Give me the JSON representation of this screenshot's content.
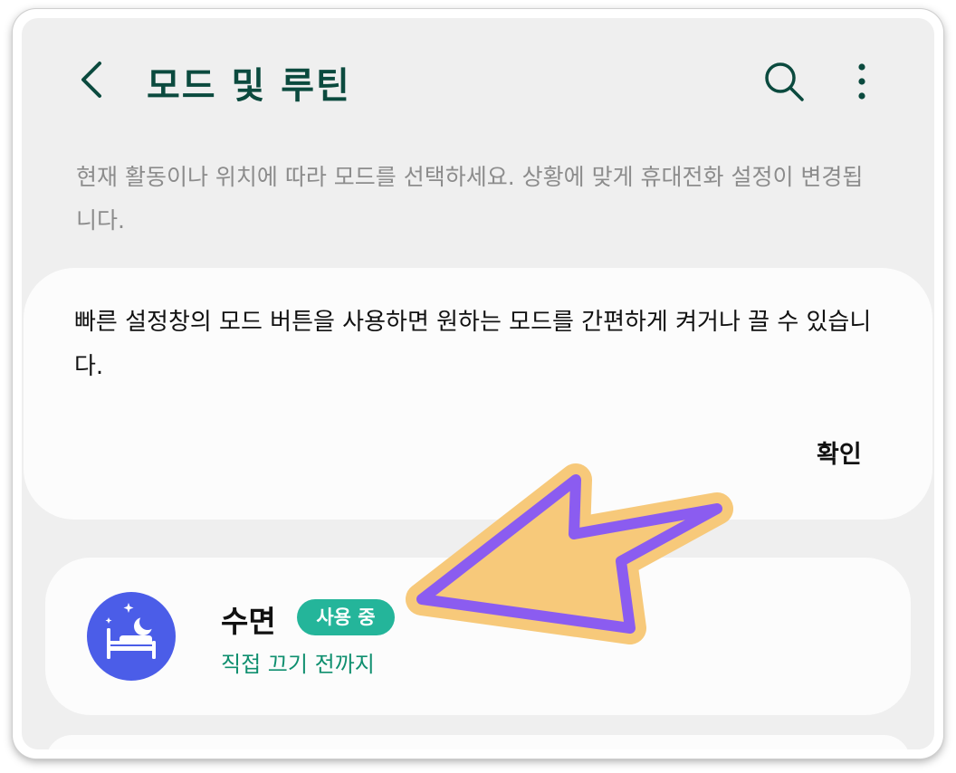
{
  "header": {
    "title": "모드 및 루틴",
    "back_icon": "chevron-left-icon",
    "search_icon": "search-icon",
    "more_icon": "more-vertical-icon"
  },
  "description": "현재 활동이나 위치에 따라 모드를 선택하세요. 상황에 맞게 휴대전화 설정이 변경됩니다.",
  "tip_card": {
    "text": "빠른 설정창의 모드 버튼을 사용하면 원하는 모드를 간편하게 켜거나 끌 수 있습니다.",
    "confirm_label": "확인"
  },
  "mode": {
    "name": "수면",
    "badge": "사용 중",
    "subtitle": "직접 끄기 전까지",
    "icon": "sleep-bed-icon"
  },
  "colors": {
    "title": "#0b4a3e",
    "badge": "#24b59a",
    "subtitle": "#0f8f6f",
    "mode_icon_bg": "#4b5de8",
    "arrow_fill": "#f7c97a",
    "arrow_stroke": "#8b5cf0"
  }
}
